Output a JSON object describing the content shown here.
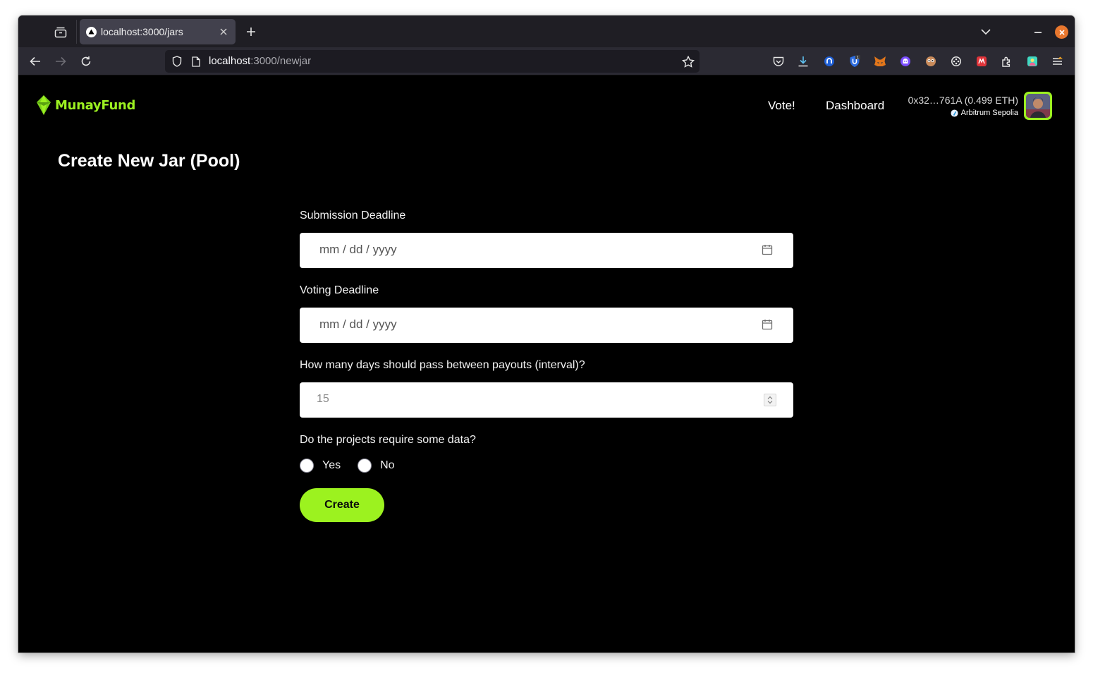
{
  "browser": {
    "tab": {
      "title": "localhost:3000/jars"
    },
    "url": {
      "host": "localhost",
      "path": ":3000/newjar"
    }
  },
  "app": {
    "brand": "MunayFund",
    "nav": {
      "vote": "Vote!",
      "dashboard": "Dashboard"
    },
    "wallet": {
      "address": "0x32…761A (0.499 ETH)",
      "network": "Arbitrum Sepolia"
    },
    "accent_color": "#9cf021"
  },
  "form": {
    "title": "Create New Jar (Pool)",
    "submission_deadline": {
      "label": "Submission Deadline",
      "placeholder": "mm / dd / yyyy"
    },
    "voting_deadline": {
      "label": "Voting Deadline",
      "placeholder": "mm / dd / yyyy"
    },
    "interval": {
      "label": "How many days should pass between payouts (interval)?",
      "value": "15"
    },
    "data_required": {
      "label": "Do the projects require some data?",
      "options": [
        "Yes",
        "No"
      ]
    },
    "submit_label": "Create"
  }
}
